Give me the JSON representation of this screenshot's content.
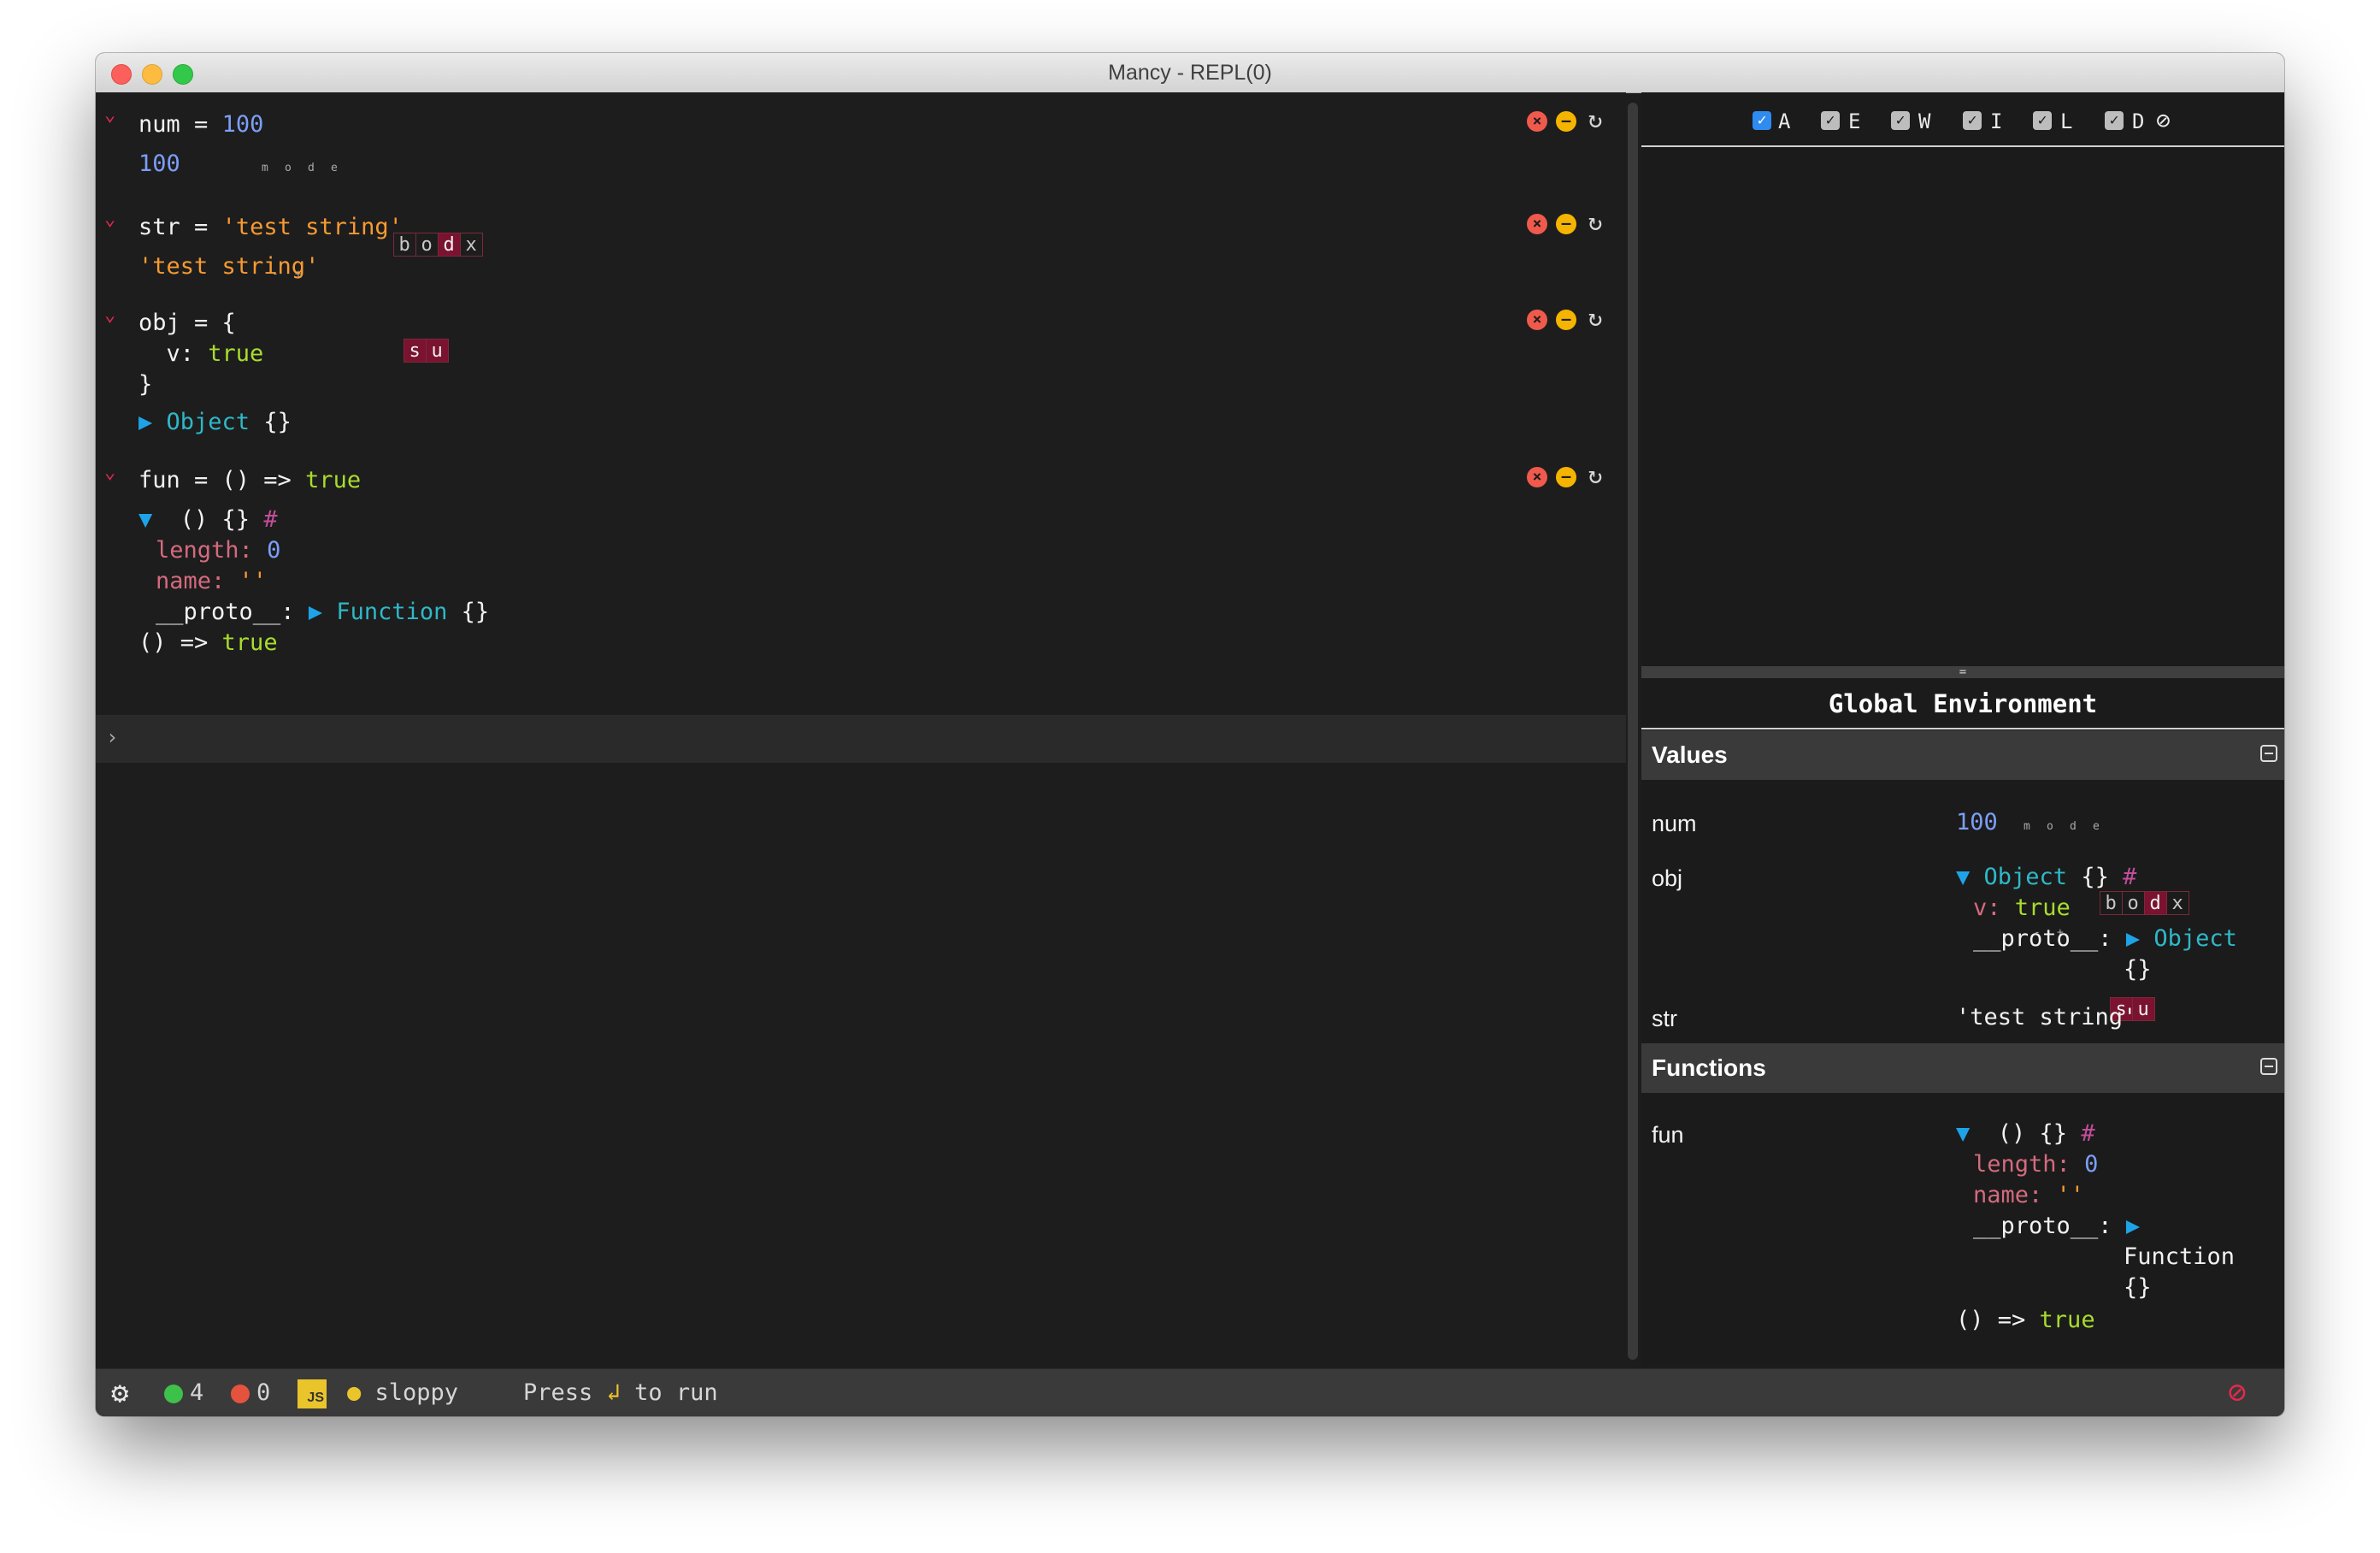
{
  "window": {
    "title": "Mancy - REPL(0)"
  },
  "cells": [
    {
      "code": [
        "num",
        " = ",
        "100"
      ],
      "output": "100"
    },
    {
      "code": [
        "str",
        " = ",
        "'test string'"
      ],
      "output": "'test string'"
    },
    {
      "code_lines": [
        "obj = {",
        "  v: true",
        "}"
      ],
      "code_parts": {
        "l1": "obj = {",
        "l2_key": "  v: ",
        "l2_val": "true",
        "l3": "}"
      },
      "output": {
        "tri": "▶",
        "type": "Object",
        "braces": "{}"
      }
    },
    {
      "code": [
        "fun = () => ",
        "true"
      ],
      "output": {
        "tri": "▼",
        "sig": "() {}",
        "hash": "#",
        "length_key": "length:",
        "length_val": "0",
        "name_key": "name:",
        "name_val": "''",
        "proto_key": "__proto__:",
        "proto_tri": "▶",
        "proto_type": "Function",
        "proto_braces": "{}",
        "fn_prefix": "() => ",
        "fn_val": "true"
      }
    }
  ],
  "modes": {
    "labels": [
      "m",
      "o",
      "d",
      "e"
    ],
    "boxes": [
      "b",
      "o",
      "d",
      "x"
    ],
    "sign_labels": [
      "-",
      "+"
    ],
    "sign_boxes": [
      "s",
      "u"
    ]
  },
  "prompt": "›",
  "filters": {
    "items": [
      "A",
      "E",
      "W",
      "I",
      "L",
      "D"
    ],
    "checked": [
      "✓",
      "✓",
      "✓",
      "✓",
      "✓",
      "✓"
    ],
    "clear_icon": "⊘"
  },
  "global_env": {
    "title": "Global Environment",
    "values_header": "Values",
    "functions_header": "Functions",
    "values": [
      {
        "name": "num",
        "value": "100"
      },
      {
        "name": "obj",
        "tri": "▼",
        "type": "Object",
        "braces": "{}",
        "hash": "#",
        "v_key": "v:",
        "v_val": "true",
        "proto_key": "__proto__:",
        "proto_tri": "▶",
        "proto_type": "Object",
        "proto_braces": "{}"
      },
      {
        "name": "str",
        "value": "'test string'"
      }
    ],
    "functions": [
      {
        "name": "fun",
        "tri": "▼",
        "sig": "() {}",
        "hash": "#",
        "length_key": "length:",
        "length_val": "0",
        "name_key": "name:",
        "name_val": "''",
        "proto_key": "__proto__:",
        "proto_tri": "▶",
        "proto_type": "Function",
        "proto_braces": "{}",
        "fn_prefix": "() => ",
        "fn_val": "true"
      }
    ]
  },
  "status": {
    "success_count": "4",
    "error_count": "0",
    "js_label": "JS",
    "mode": "sloppy",
    "hint_prefix": "Press",
    "enter_symbol": "↲",
    "hint_suffix": "to run",
    "no_icon": "⊘"
  },
  "colors": {
    "bg": "#1d1d1d",
    "number": "#7c9ef7",
    "string": "#f79a32",
    "keyword": "#a8dc2e",
    "object": "#2fb8c8",
    "chevron": "#e5294f"
  }
}
